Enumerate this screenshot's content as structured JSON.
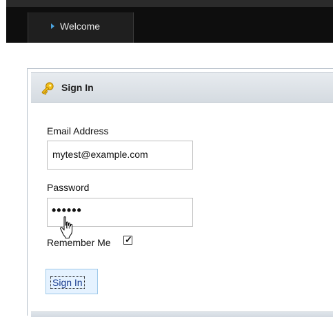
{
  "topbar": {
    "tab_label": "Welcome",
    "tab_icon": "triangle-right-icon"
  },
  "panel": {
    "title": "Sign In",
    "icon": "key-icon"
  },
  "form": {
    "email_label": "Email Address",
    "email_value": "mytest@example.com",
    "password_label": "Password",
    "password_value": "••••••",
    "remember_label": "Remember Me",
    "remember_checked": true,
    "submit_label": "Sign In"
  },
  "cursor": {
    "icon": "hand-pointer-icon"
  },
  "colors": {
    "topbar": "#0e0e0e",
    "tab": "#1f1f1f",
    "tab_arrow": "#4aa3df",
    "panel_header": "#dfe4e9",
    "button_bg": "#e5f2ff",
    "button_border": "#9cc8e9",
    "button_text": "#1a3c8f"
  }
}
